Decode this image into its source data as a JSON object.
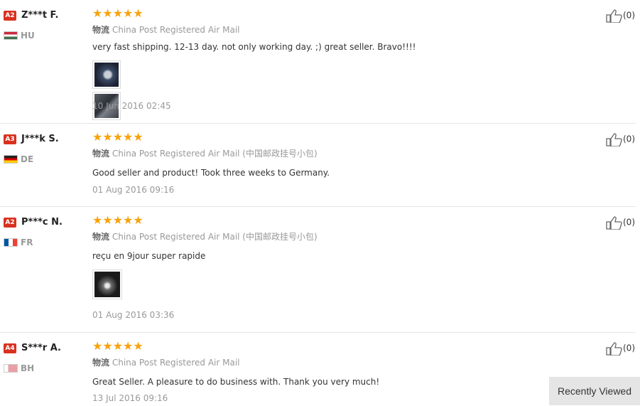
{
  "reviews": [
    {
      "level": "A2",
      "user": "Z***t F.",
      "country_code": "HU",
      "stars": "★★★★★",
      "rating": 5,
      "logistics_label": "物流",
      "logistics": "China Post Registered Air Mail",
      "text": "very fast shipping. 12-13 day. not only working day. ;) great seller. Bravo!!!!",
      "date": "10 Jun 2016 02:45",
      "helpful": "(0)",
      "photos": 2
    },
    {
      "level": "A3",
      "user": "J***k S.",
      "country_code": "DE",
      "stars": "★★★★★",
      "rating": 5,
      "logistics_label": "物流",
      "logistics": "China Post Registered Air Mail (中国邮政挂号小包)",
      "text": "Good seller and product! Took three weeks to Germany.",
      "date": "01 Aug 2016 09:16",
      "helpful": "(0)",
      "photos": 0
    },
    {
      "level": "A2",
      "user": "P***c N.",
      "country_code": "FR",
      "stars": "★★★★★",
      "rating": 5,
      "logistics_label": "物流",
      "logistics": "China Post Registered Air Mail (中国邮政挂号小包)",
      "text": "reçu en 9jour super rapide",
      "date": "01 Aug 2016 03:36",
      "helpful": "(0)",
      "photos": 1
    },
    {
      "level": "A4",
      "user": "S***r A.",
      "country_code": "BH",
      "stars": "★★★★★",
      "rating": 5,
      "logistics_label": "物流",
      "logistics": "China Post Registered Air Mail",
      "text": "Great Seller. A pleasure to do business with. Thank you very much!",
      "date": "13 Jul 2016 09:16",
      "helpful": "(0)",
      "photos": 0
    }
  ],
  "recently_viewed": "Recently Viewed",
  "colors": {
    "level_badge": "#d8311f",
    "stars": "#f7a30c",
    "muted": "#999999"
  }
}
